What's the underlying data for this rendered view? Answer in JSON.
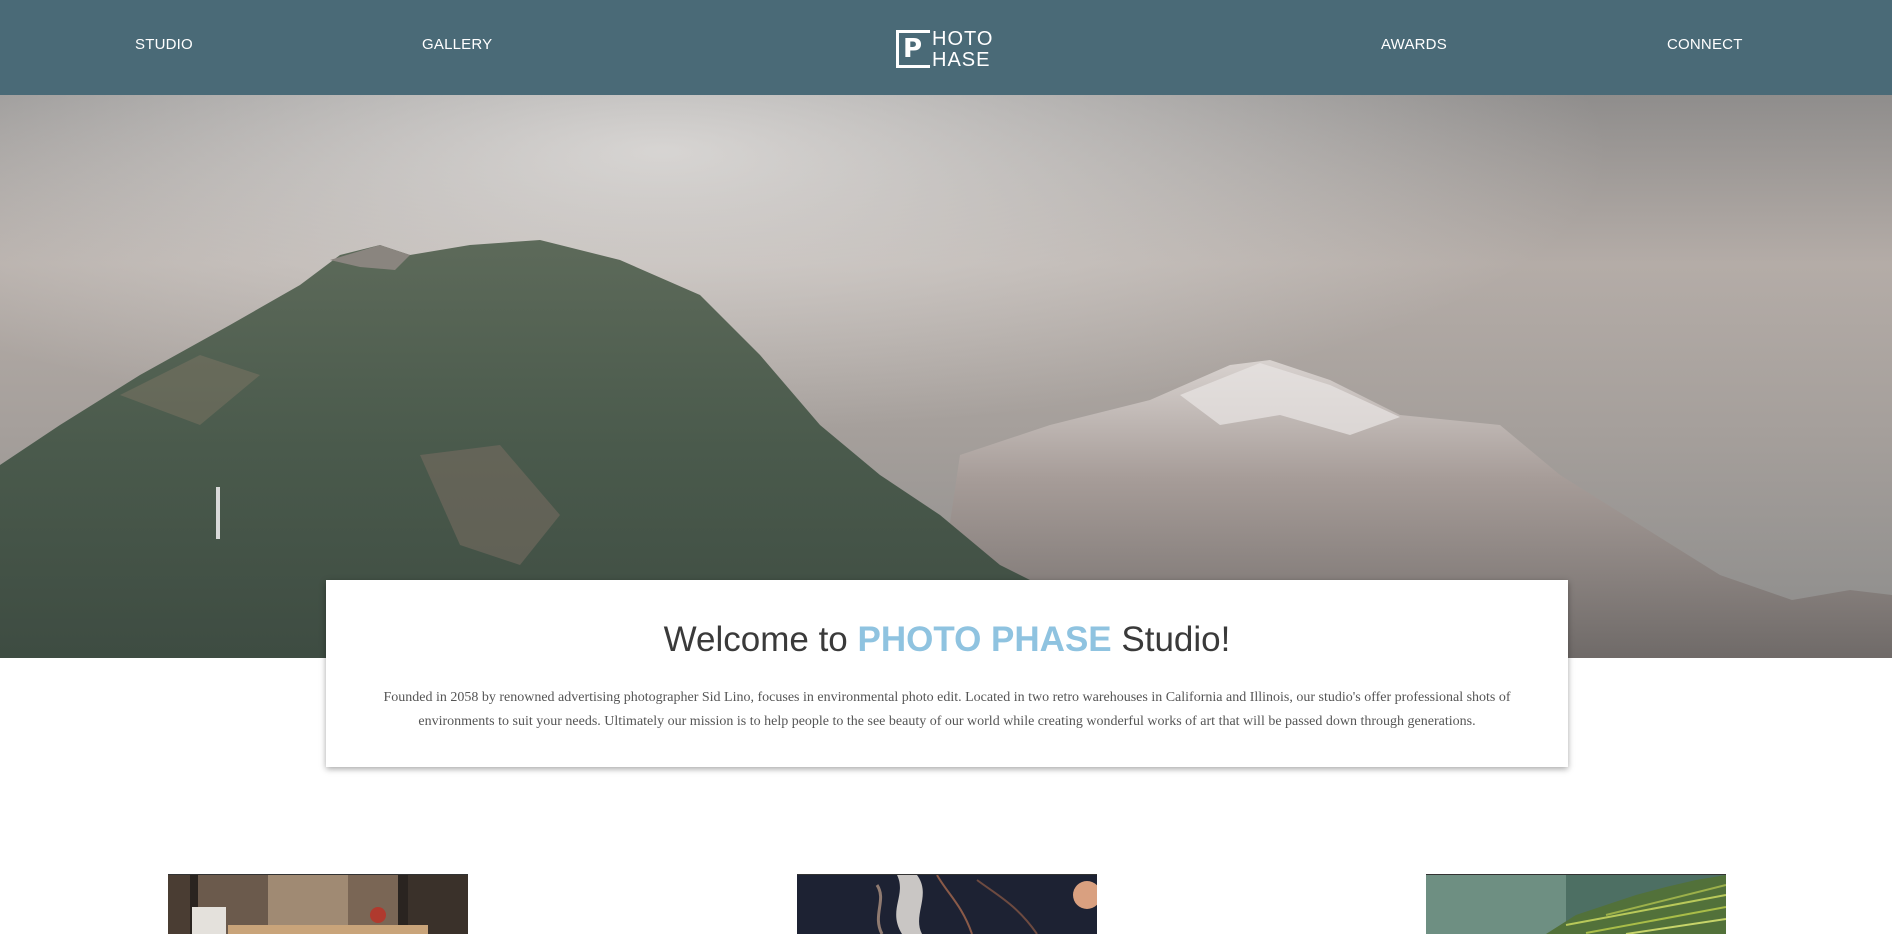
{
  "nav": {
    "items": [
      "STUDIO",
      "GALLERY",
      "AWARDS",
      "CONNECT"
    ],
    "logo": {
      "mark": "P",
      "line1": "HOTO",
      "line2": "HASE"
    }
  },
  "welcome": {
    "title_pre": "Welcome to",
    "title_brand": "PHOTO PHASE",
    "title_post": "Studio!",
    "body": "Founded in 2058 by renowned advertising photographer Sid Lino, focuses in environmental photo edit. Located in two retro warehouses in California and Illinois, our studio's offer professional shots of environments to suit your needs. Ultimately our mission is to help people to the see beauty of our world while creating wonderful works of art that will be passed down through generations."
  },
  "colors": {
    "nav_bg": "#4a6a77",
    "brand_accent": "#8fc3e0",
    "text_dark": "#3a3a3a"
  }
}
